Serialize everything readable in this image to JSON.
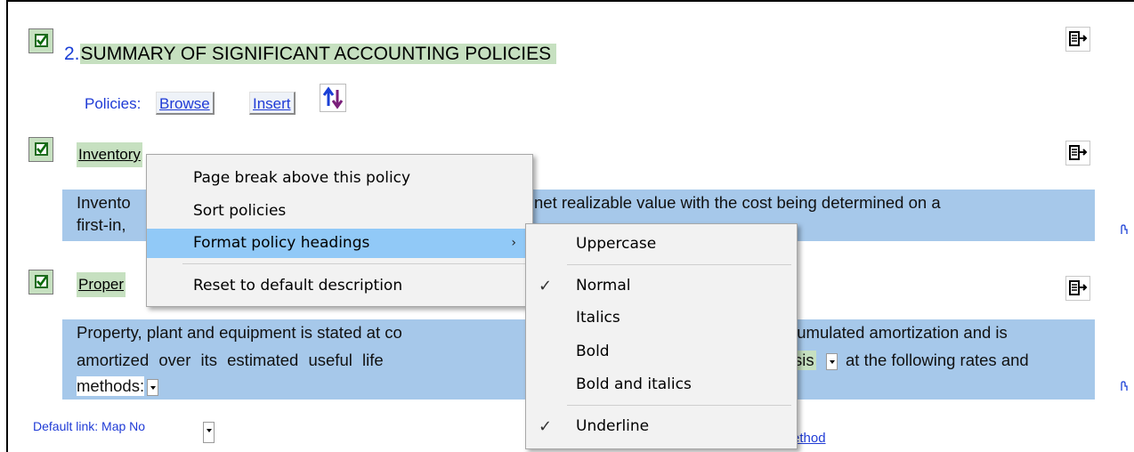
{
  "section": {
    "number": "2.",
    "title": "SUMMARY OF SIGNIFICANT ACCOUNTING POLICIES"
  },
  "policies": {
    "label": "Policies:",
    "browse": "Browse",
    "insert": "Insert"
  },
  "policy_items": [
    {
      "heading": "Inventory",
      "desc_line1_left": "Invento",
      "desc_line1_right": "net realizable value with the cost being determined on a",
      "desc_line2": "first-in,"
    },
    {
      "heading": "Proper",
      "desc_line1_left": "Property, plant and equipment is stated at co",
      "desc_line1_right": "cumulated amortization and is",
      "desc_line2_left": "amortized  over  its  estimated  useful  life",
      "desc_line2_mid": "sis",
      "desc_line2_right": "at the following rates and",
      "desc_line3": "methods:"
    }
  ],
  "footer": {
    "default_link": "Default link: Map No",
    "method_link": "ethod"
  },
  "context_menu": {
    "items": [
      "Page break above this policy",
      "Sort policies",
      "Format policy headings",
      "Reset to default description"
    ]
  },
  "submenu": {
    "items": [
      "Uppercase",
      "Normal",
      "Italics",
      "Bold",
      "Bold and italics",
      "Underline"
    ],
    "checked": [
      "Normal",
      "Underline"
    ]
  },
  "colors": {
    "heading_highlight": "#c6e0c0",
    "description_band": "#a6c8ea",
    "link_blue": "#1f3bd6",
    "menu_hover": "#91c9f7"
  }
}
